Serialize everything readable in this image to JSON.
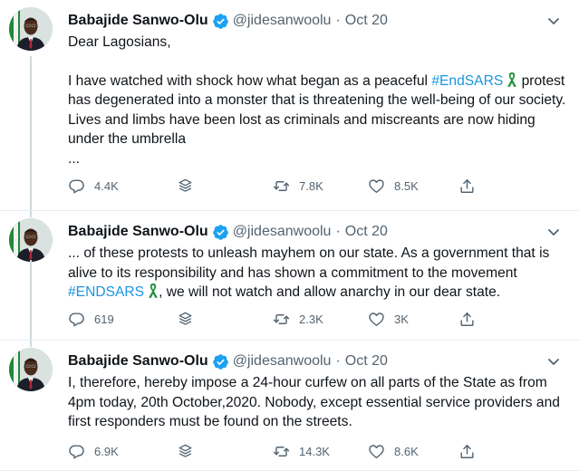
{
  "colors": {
    "text": "#0f1419",
    "secondary": "#536471",
    "hashtag": "#1b95e0",
    "verified": "#1da1f2",
    "ribbon": "#1f8f3a"
  },
  "icons": {
    "verified": "verified-badge-icon",
    "more": "more-chevron-icon",
    "reply": "reply-icon",
    "save": "save-layers-icon",
    "retweet": "retweet-icon",
    "like": "like-heart-icon",
    "share": "share-icon"
  },
  "tweets": [
    {
      "author": "Babajide Sanwo-Olu",
      "handle": "@jidesanwoolu",
      "separator": "·",
      "date": "Oct 20",
      "greeting": "Dear Lagosians,",
      "text_before_tag": "I have watched with shock how what began as a peaceful ",
      "hashtag": "#EndSARS",
      "text_after_tag": "protest has degenerated into a monster that is threatening the well-being of our society. Lives and limbs have been lost as criminals and miscreants are now hiding under the umbrella",
      "ellipsis": "...",
      "stats": {
        "replies": "4.4K",
        "retweets": "7.8K",
        "likes": "8.5K"
      }
    },
    {
      "author": "Babajide Sanwo-Olu",
      "handle": "@jidesanwoolu",
      "separator": "·",
      "date": "Oct 20",
      "text_before_tag": "... of these protests to unleash mayhem on our state. As a government that is alive to its responsibility and has shown a commitment to the movement ",
      "hashtag": "#ENDSARS",
      "text_after_tag": ", we will not watch and allow anarchy in our dear state.",
      "stats": {
        "replies": "619",
        "retweets": "2.3K",
        "likes": "3K"
      }
    },
    {
      "author": "Babajide Sanwo-Olu",
      "handle": "@jidesanwoolu",
      "separator": "·",
      "date": "Oct 20",
      "text": "I, therefore, hereby impose a 24-hour curfew on all parts of the State as from 4pm today, 20th October,2020. Nobody, except essential service providers and first responders must be found on the streets.",
      "stats": {
        "replies": "6.9K",
        "retweets": "14.3K",
        "likes": "8.6K"
      }
    }
  ]
}
